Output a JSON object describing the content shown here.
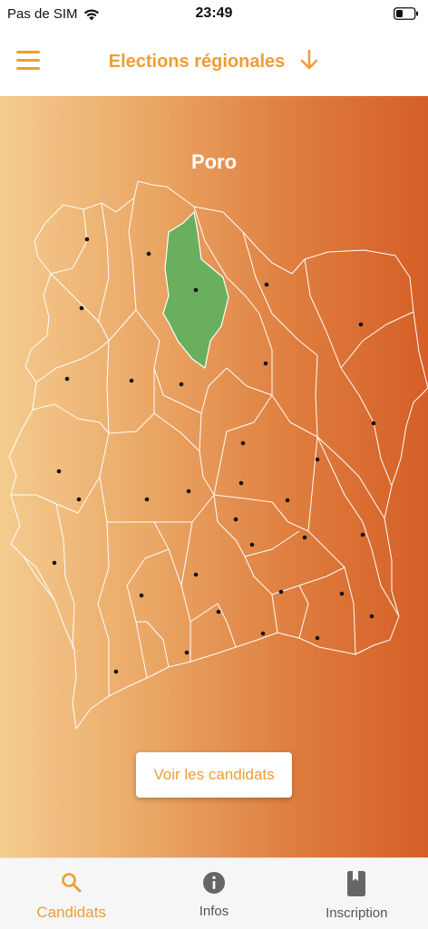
{
  "status_bar": {
    "carrier": "Pas de SIM",
    "time": "23:49",
    "icons": [
      "wifi-icon",
      "battery-icon"
    ]
  },
  "header": {
    "title": "Elections régionales",
    "menu_icon": "hamburger-menu-icon",
    "title_icon": "arrow-down-icon"
  },
  "map": {
    "selected_region": "Poro",
    "colors": {
      "gradient_left": "#f4cc8f",
      "gradient_right": "#d55f26",
      "selected_fill": "#6aaf5e",
      "borders": "#ffffff",
      "dots": "#111111"
    }
  },
  "cta": {
    "label": "Voir les candidats"
  },
  "tab_bar": {
    "accent": "#ee9d33",
    "inactive": "#555555",
    "items": [
      {
        "label": "Candidats",
        "icon": "search-icon",
        "active": true
      },
      {
        "label": "Infos",
        "icon": "info-icon",
        "active": false
      },
      {
        "label": "Inscription",
        "icon": "bookmark-book-icon",
        "active": false
      }
    ]
  }
}
